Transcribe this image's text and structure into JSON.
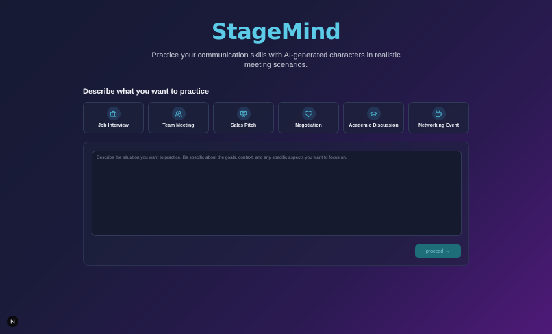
{
  "hero": {
    "title": "StageMind",
    "tagline": "Practice your communication skills with AI-generated characters in realistic meeting scenarios."
  },
  "section": {
    "title": "Describe what you want to practice"
  },
  "scenarios": [
    {
      "label": "Job Interview",
      "icon": "briefcase-icon"
    },
    {
      "label": "Team Meeting",
      "icon": "users-icon"
    },
    {
      "label": "Sales Pitch",
      "icon": "presentation-icon"
    },
    {
      "label": "Negotiation",
      "icon": "heart-icon"
    },
    {
      "label": "Academic Discussion",
      "icon": "graduation-cap-icon"
    },
    {
      "label": "Networking Event",
      "icon": "coffee-icon"
    }
  ],
  "description": {
    "value": "",
    "placeholder": "Describe the situation you want to practice. Be specific about the goals, context, and any specific aspects you want to focus on."
  },
  "actions": {
    "proceed_label": "proceed",
    "proceed_arrow": "→"
  },
  "colors": {
    "brand": "#5ccbe8",
    "accent_button": "#1d6e79",
    "icon_stroke": "#4fb6d0"
  }
}
